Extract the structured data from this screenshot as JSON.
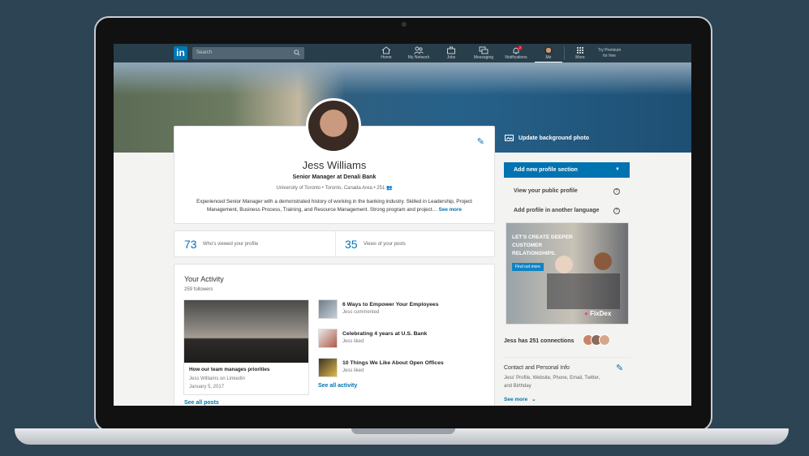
{
  "nav": {
    "logo": "in",
    "search_placeholder": "Search",
    "items": [
      {
        "label": "Home",
        "icon": "home-icon"
      },
      {
        "label": "My Network",
        "icon": "network-icon"
      },
      {
        "label": "Jobs",
        "icon": "briefcase-icon"
      },
      {
        "label": "Messaging",
        "icon": "messaging-icon"
      },
      {
        "label": "Notifications",
        "icon": "bell-icon",
        "badge": "2"
      },
      {
        "label": "Me",
        "icon": "avatar-icon"
      },
      {
        "label": "More",
        "icon": "grid-icon"
      }
    ],
    "premium_line1": "Try Premium",
    "premium_line2": "for free"
  },
  "profile": {
    "name": "Jess Williams",
    "headline": "Senior Manager at Denali Bank",
    "school": "University of Toronto",
    "location": "Toronto, Canada Area",
    "connections_count": "251",
    "summary": "Experienced Senior Manager with a demonstrated history of working in the banking industry. Skilled in Leadership, Project Management, Business Process, Training, and Resource Management. Strong program and project…",
    "see_more": "See more"
  },
  "stats": {
    "views_profile_num": "73",
    "views_profile_label": "Who's viewed your profile",
    "views_posts_num": "35",
    "views_posts_label": "Views of your posts"
  },
  "activity": {
    "title": "Your Activity",
    "followers": "259 followers",
    "featured_post": {
      "title": "How our team manages priorities",
      "author": "Jess Williams on LinkedIn",
      "date": "January 5, 2017"
    },
    "items": [
      {
        "title": "6 Ways to Empower Your Employees",
        "sub": "Jess commented"
      },
      {
        "title": "Celebrating 4 years at U.S. Bank",
        "sub": "Jess liked"
      },
      {
        "title": "10 Things We Like About Open Offices",
        "sub": "Jess liked"
      }
    ],
    "see_all_activity": "See all activity",
    "see_all_posts": "See all posts"
  },
  "right": {
    "update_bg": "Update background photo",
    "add_section": "Add new profile section",
    "view_public": "View your public profile",
    "add_language": "Add profile in another language",
    "ad": {
      "text": "LET'S CREATE DEEPER CUSTOMER RELATIONSHIPS.",
      "button": "Find out more",
      "brand": "FixDex"
    },
    "connections": "Jess has 251 connections",
    "contact_title": "Contact and Personal Info",
    "contact_desc": "Jess' Profile, Website, Phone, Email, Twitter, and Birthday",
    "see_more": "See more"
  },
  "colors": {
    "accent": "#0073b1",
    "nav": "#283e4a",
    "badge": "#d11124"
  }
}
